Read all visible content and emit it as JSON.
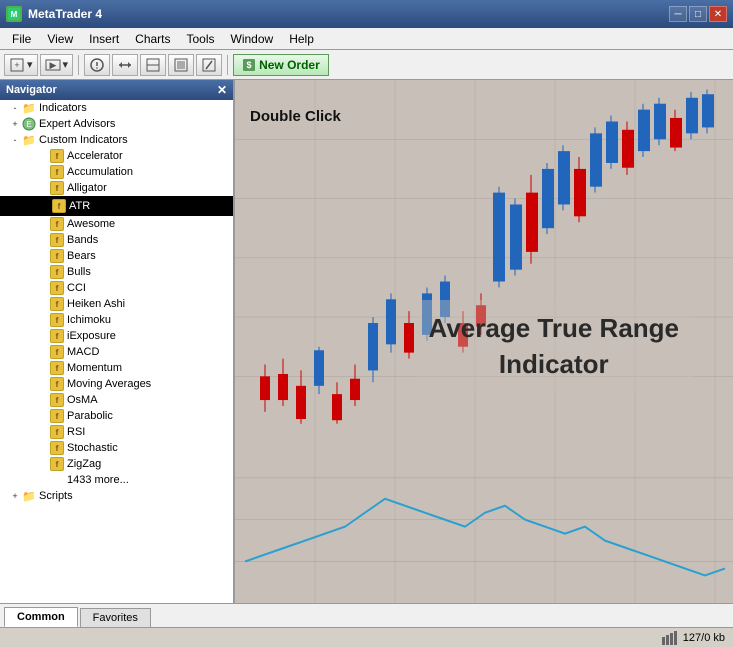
{
  "titleBar": {
    "title": "MetaTrader 4",
    "minimizeLabel": "─",
    "maximizeLabel": "□",
    "closeLabel": "✕"
  },
  "menuBar": {
    "items": [
      "File",
      "View",
      "Insert",
      "Charts",
      "Tools",
      "Window",
      "Help"
    ]
  },
  "toolbar": {
    "newOrderLabel": "New Order"
  },
  "navigator": {
    "title": "Navigator",
    "sections": [
      {
        "id": "indicators",
        "label": "Indicators",
        "type": "folder",
        "expanded": true
      },
      {
        "id": "expert-advisors",
        "label": "Expert Advisors",
        "type": "folder",
        "expanded": false
      },
      {
        "id": "custom-indicators",
        "label": "Custom Indicators",
        "type": "folder",
        "expanded": true
      },
      {
        "id": "accelerator",
        "label": "Accelerator",
        "type": "indicator"
      },
      {
        "id": "accumulation",
        "label": "Accumulation",
        "type": "indicator"
      },
      {
        "id": "alligator",
        "label": "Alligator",
        "type": "indicator"
      },
      {
        "id": "atr",
        "label": "ATR",
        "type": "indicator",
        "selected": true
      },
      {
        "id": "awesome",
        "label": "Awesome",
        "type": "indicator"
      },
      {
        "id": "bands",
        "label": "Bands",
        "type": "indicator"
      },
      {
        "id": "bears",
        "label": "Bears",
        "type": "indicator"
      },
      {
        "id": "bulls",
        "label": "Bulls",
        "type": "indicator"
      },
      {
        "id": "cci",
        "label": "CCI",
        "type": "indicator"
      },
      {
        "id": "heiken-ashi",
        "label": "Heiken Ashi",
        "type": "indicator"
      },
      {
        "id": "ichimoku",
        "label": "Ichimoku",
        "type": "indicator"
      },
      {
        "id": "iexposure",
        "label": "iExposure",
        "type": "indicator"
      },
      {
        "id": "macd",
        "label": "MACD",
        "type": "indicator"
      },
      {
        "id": "momentum",
        "label": "Momentum",
        "type": "indicator"
      },
      {
        "id": "moving-averages",
        "label": "Moving Averages",
        "type": "indicator"
      },
      {
        "id": "osma",
        "label": "OsMA",
        "type": "indicator"
      },
      {
        "id": "parabolic",
        "label": "Parabolic",
        "type": "indicator"
      },
      {
        "id": "rsi",
        "label": "RSI",
        "type": "indicator"
      },
      {
        "id": "stochastic",
        "label": "Stochastic",
        "type": "indicator"
      },
      {
        "id": "zigzag",
        "label": "ZigZag",
        "type": "indicator"
      },
      {
        "id": "more",
        "label": "1433 more...",
        "type": "more"
      },
      {
        "id": "scripts",
        "label": "Scripts",
        "type": "folder",
        "expanded": false
      }
    ]
  },
  "chart": {
    "doubleClickLabel": "Double Click",
    "atrLabel": "Average True Range\nIndicator"
  },
  "tabs": [
    {
      "id": "common",
      "label": "Common",
      "active": true
    },
    {
      "id": "favorites",
      "label": "Favorites",
      "active": false
    }
  ],
  "statusBar": {
    "traffic": "127/0 kb"
  },
  "icons": {
    "folder": "📁",
    "indicator": "f",
    "expand": "+",
    "collapse": "-",
    "minus": "─",
    "square": "□",
    "close": "✕"
  }
}
